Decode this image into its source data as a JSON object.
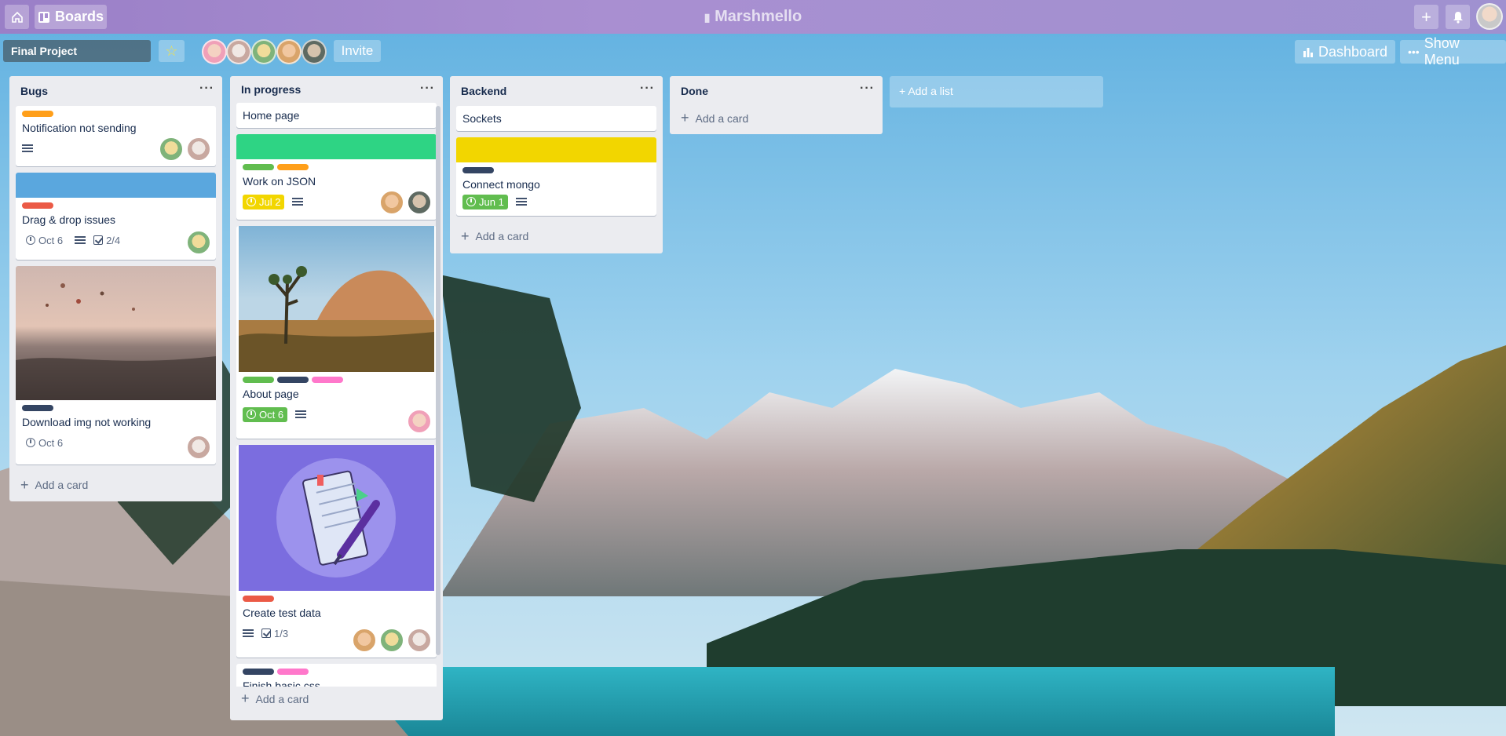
{
  "topbar": {
    "home_icon": "home-icon",
    "boards_label": "Boards",
    "logo_text": "Marshmello",
    "add_icon": "plus-icon",
    "bell_icon": "bell-icon"
  },
  "board": {
    "name": "Final Project",
    "invite_label": "Invite",
    "dashboard_label": "Dashboard",
    "menu_label": "Show Menu"
  },
  "colors": {
    "green": "#61bd4f",
    "yellow": "#f2d600",
    "orange": "#ff9f1a",
    "red": "#eb5a46",
    "navy": "#344563",
    "pink": "#ff78cb",
    "sky": "#5aa7de",
    "teal": "#2ed484"
  },
  "lists": [
    {
      "title": "Bugs",
      "add_label": "Add a card",
      "cards": [
        {
          "title": "Notification not sending"
        },
        {
          "title": "Drag & drop issues",
          "date": "Oct 6",
          "checklist": "2/4"
        },
        {
          "title": "Download img not working",
          "date": "Oct 6"
        }
      ]
    },
    {
      "title": "In progress",
      "add_label": "Add a card",
      "cards": [
        {
          "title": "Home page"
        },
        {
          "title": "Work on JSON",
          "date": "Jul 2"
        },
        {
          "title": "About page",
          "date": "Oct 6"
        },
        {
          "title": "Create test data",
          "checklist": "1/3"
        },
        {
          "title": "Finish basic css"
        }
      ]
    },
    {
      "title": "Backend",
      "add_label": "Add a card",
      "cards": [
        {
          "title": "Sockets"
        },
        {
          "title": "Connect mongo",
          "date": "Jun 1"
        }
      ]
    },
    {
      "title": "Done",
      "add_label": "Add a card",
      "cards": []
    }
  ],
  "add_list_label": "Add a list"
}
